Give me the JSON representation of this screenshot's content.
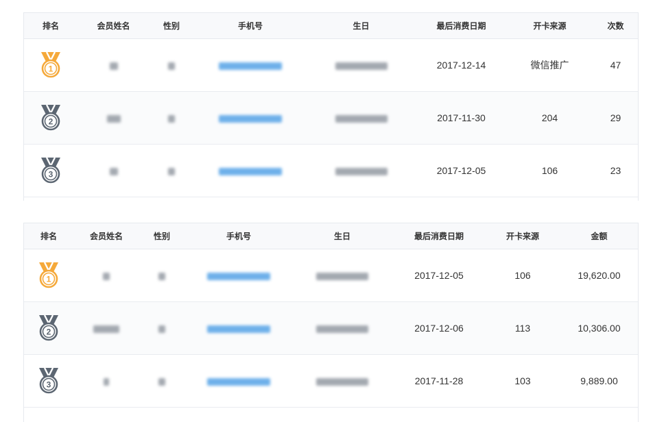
{
  "colors": {
    "gold": "#f5a93a",
    "silver": "#5c6672",
    "link_blue": "#5fa8e8",
    "header_bg": "#f8f9fb",
    "border": "#e6e9ee"
  },
  "table1": {
    "headers": [
      "排名",
      "会员姓名",
      "性别",
      "手机号",
      "生日",
      "最后消费日期",
      "开卡来源",
      "次数"
    ],
    "rows": [
      {
        "rank": "1",
        "medal": "gold",
        "last_date": "2017-12-14",
        "source": "微信推广",
        "value": "47"
      },
      {
        "rank": "2",
        "medal": "silver",
        "last_date": "2017-11-30",
        "source": "204",
        "value": "29"
      },
      {
        "rank": "3",
        "medal": "silver",
        "last_date": "2017-12-05",
        "source": "106",
        "value": "23"
      }
    ]
  },
  "table2": {
    "headers": [
      "排名",
      "会员姓名",
      "性别",
      "手机号",
      "生日",
      "最后消费日期",
      "开卡来源",
      "金额"
    ],
    "rows": [
      {
        "rank": "1",
        "medal": "gold",
        "last_date": "2017-12-05",
        "source": "106",
        "value": "19,620.00"
      },
      {
        "rank": "2",
        "medal": "silver",
        "last_date": "2017-12-06",
        "source": "113",
        "value": "10,306.00"
      },
      {
        "rank": "3",
        "medal": "silver",
        "last_date": "2017-11-28",
        "source": "103",
        "value": "9,889.00"
      }
    ]
  }
}
